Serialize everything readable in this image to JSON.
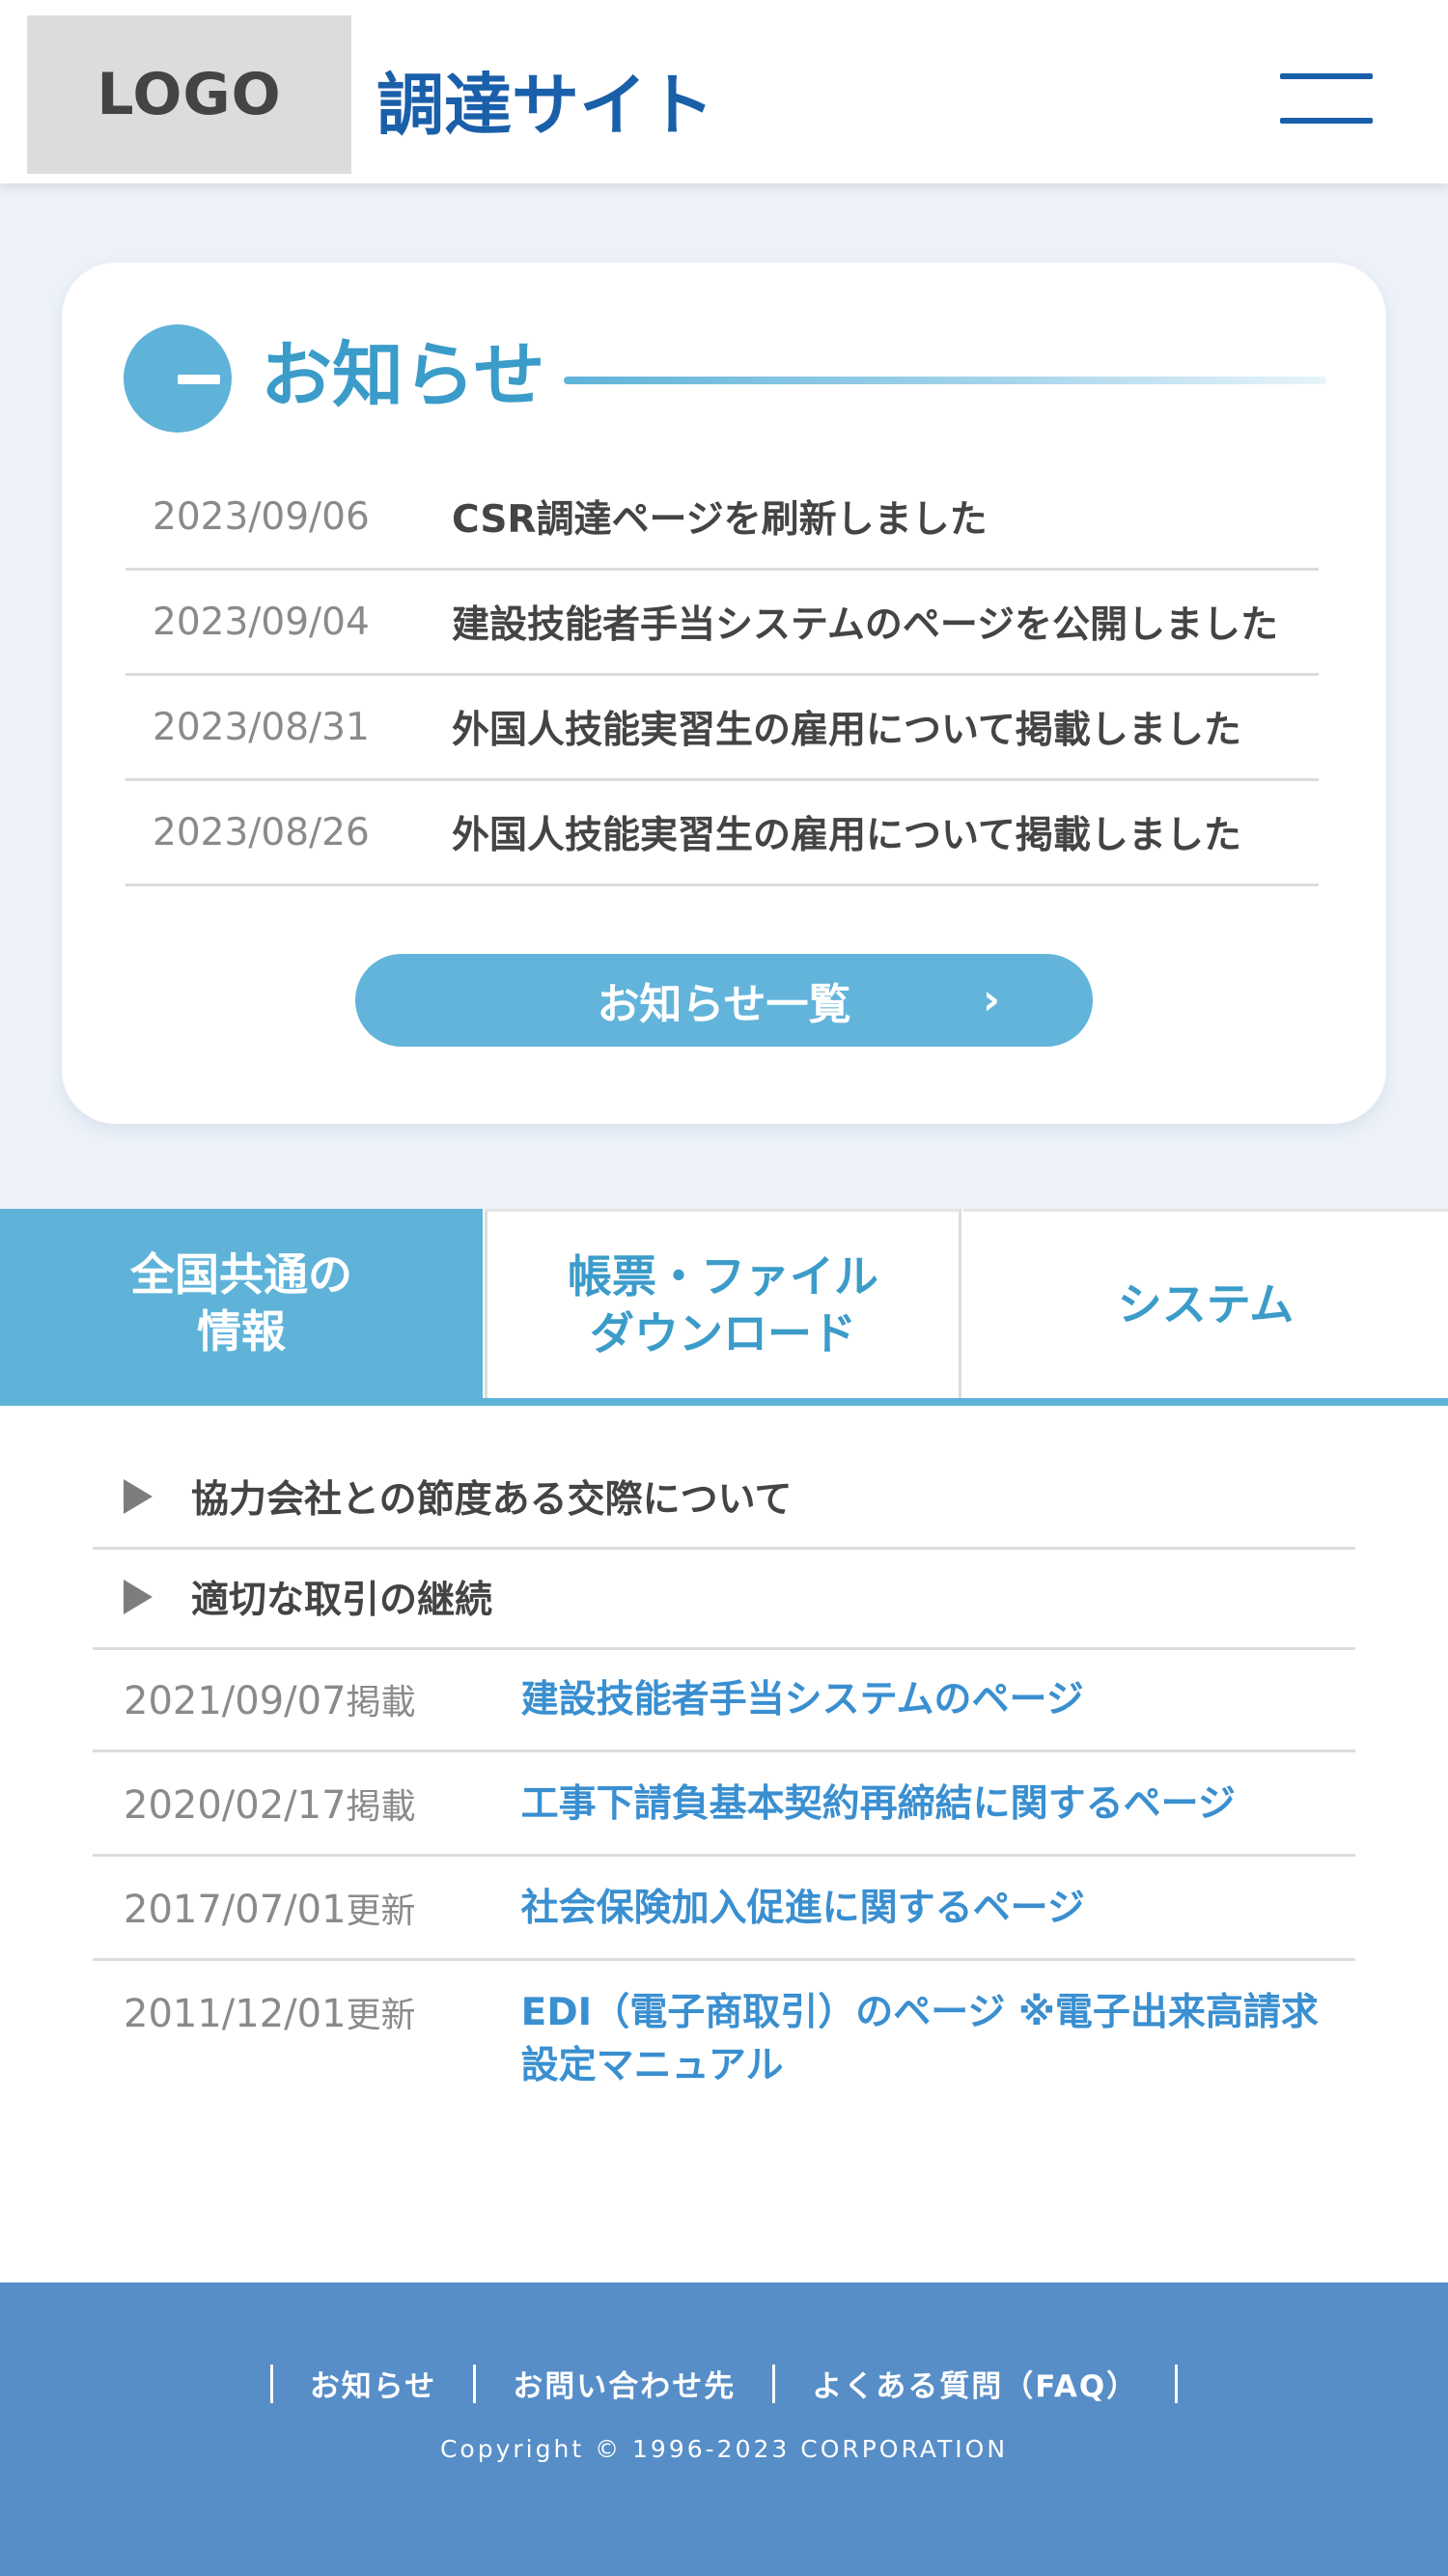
{
  "header": {
    "logo_text": "LOGO",
    "site_title": "調達サイト",
    "menu_icon": "hamburger-menu-icon"
  },
  "news": {
    "heading": "お知らせ",
    "items": [
      {
        "date": "2023/09/06",
        "text": "CSR調達ページを刷新しました"
      },
      {
        "date": "2023/09/04",
        "text": "建設技能者手当システムのページを公開しました"
      },
      {
        "date": "2023/08/31",
        "text": "外国人技能実習生の雇用について掲載しました"
      },
      {
        "date": "2023/08/26",
        "text": "外国人技能実習生の雇用について掲載しました"
      }
    ],
    "all_button_label": "お知らせ一覧",
    "all_button_chevron": "›"
  },
  "tabs": [
    {
      "label": "全国共通の\n情報",
      "active": true
    },
    {
      "label": "帳票・ファイル\nダウンロード",
      "active": false
    },
    {
      "label": "システム",
      "active": false
    }
  ],
  "content": {
    "toggles": [
      "協力会社との節度ある交際について",
      "適切な取引の継続"
    ],
    "links": [
      {
        "date": "2021/09/07",
        "suffix": "掲載",
        "text": "建設技能者手当システムのページ"
      },
      {
        "date": "2020/02/17",
        "suffix": "掲載",
        "text": "工事下請負基本契約再締結に関するページ"
      },
      {
        "date": "2017/07/01",
        "suffix": "更新",
        "text": "社会保険加入促進に関するページ"
      },
      {
        "date": "2011/12/01",
        "suffix": "更新",
        "text": "EDI（電子商取引）のページ ※電子出来高請求設定マニュアル"
      }
    ]
  },
  "footer": {
    "links": [
      "お知らせ",
      "お問い合わせ先",
      "よくある質問（FAQ）"
    ],
    "copyright": "Copyright © 1996-2023 CORPORATION"
  },
  "colors": {
    "primary_blue": "#1a5fa9",
    "accent_light_blue": "#5fb3d9",
    "link_blue": "#3a8fd0",
    "footer_blue": "#578ec8",
    "page_bg": "#edf2f9"
  }
}
